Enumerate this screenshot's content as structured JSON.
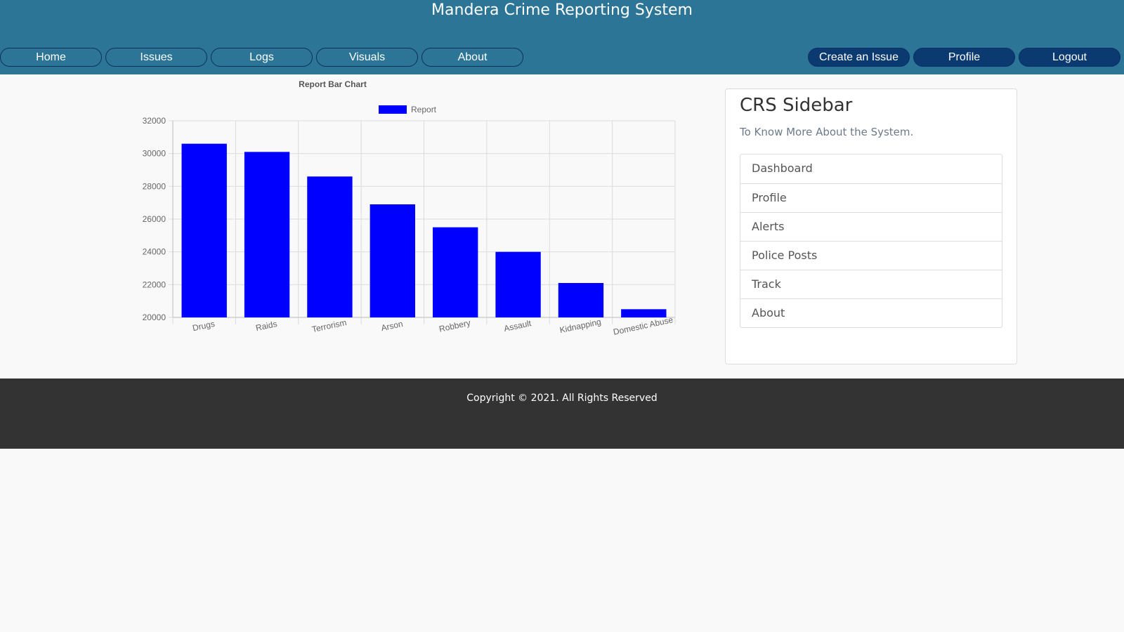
{
  "app": {
    "title": "Mandera Crime Reporting System"
  },
  "nav": {
    "left": [
      {
        "label": "Home",
        "name": "nav-home-button"
      },
      {
        "label": "Issues",
        "name": "nav-issues-button"
      },
      {
        "label": "Logs",
        "name": "nav-logs-button"
      },
      {
        "label": "Visuals",
        "name": "nav-visuals-button"
      },
      {
        "label": "About",
        "name": "nav-about-button"
      }
    ],
    "right": [
      {
        "label": "Create an Issue",
        "name": "create-issue-button"
      },
      {
        "label": "Profile",
        "name": "nav-profile-button"
      },
      {
        "label": "Logout",
        "name": "logout-button"
      }
    ]
  },
  "chart_data": {
    "type": "bar",
    "title": "Report Bar Chart",
    "categories": [
      "Drugs",
      "Raids",
      "Terrorism",
      "Arson",
      "Robbery",
      "Assault",
      "Kidnapping",
      "Domestic Abuse"
    ],
    "series": [
      {
        "name": "Report",
        "color": "#0000ff",
        "values": [
          30600,
          30100,
          28600,
          26900,
          25500,
          24000,
          22100,
          20500
        ]
      }
    ],
    "ylim": [
      20000,
      32000
    ],
    "yticks": [
      32000,
      30000,
      28000,
      26000,
      24000,
      22000,
      20000
    ],
    "grid": true,
    "legend_position": "top",
    "xlabel": "",
    "ylabel": ""
  },
  "sidebar": {
    "title": "CRS Sidebar",
    "subtitle": "To Know More About the System.",
    "items": [
      {
        "label": "Dashboard"
      },
      {
        "label": "Profile"
      },
      {
        "label": "Alerts"
      },
      {
        "label": "Police Posts"
      },
      {
        "label": "Track"
      },
      {
        "label": "About"
      }
    ]
  },
  "footer": {
    "copyright": "Copyright © 2021. All Rights Reserved"
  }
}
